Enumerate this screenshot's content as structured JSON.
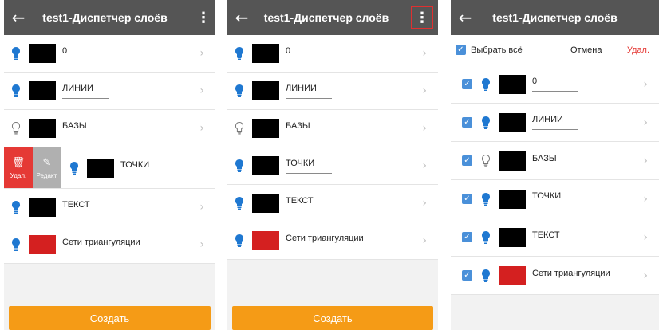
{
  "title": "test1-Диспетчер слоёв",
  "colors": {
    "topbar": "#555555",
    "accent": "#f59b16",
    "bulb_on": "#1f78d1",
    "delete": "#e53935",
    "checkbox": "#4a90d9"
  },
  "create_label": "Создать",
  "swipe": {
    "delete_label": "Удал.",
    "edit_label": "Редакт."
  },
  "selection": {
    "select_all_label": "Выбрать всё",
    "cancel_label": "Отмена",
    "delete_label": "Удал."
  },
  "layers": [
    {
      "name": "0",
      "color": "#000000",
      "visible": true,
      "underline": true
    },
    {
      "name": "ЛИНИИ",
      "color": "#000000",
      "visible": true,
      "underline": true
    },
    {
      "name": "БАЗЫ",
      "color": "#000000",
      "visible": false,
      "underline": false
    },
    {
      "name": "ТОЧКИ",
      "color": "#000000",
      "visible": true,
      "underline": true
    },
    {
      "name": "ТЕКСТ",
      "color": "#000000",
      "visible": true,
      "underline": false
    },
    {
      "name": "Сети триангуляции",
      "color": "#d42020",
      "visible": true,
      "underline": false
    }
  ]
}
